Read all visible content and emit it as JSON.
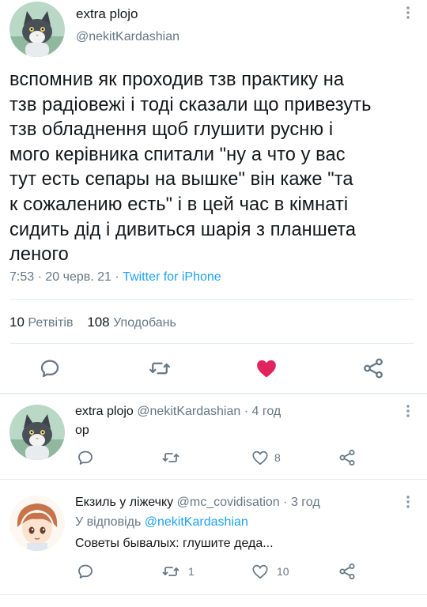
{
  "main_tweet": {
    "display_name": "extra plojo",
    "handle": "@nekitKardashian",
    "text_lines": [
      "вспомнив як проходив тзв практику на",
      "тзв радіовежі і тоді сказали що привезуть",
      "тзв обладнення щоб глушити русню і",
      "мого керівника спитали \"ну а что у вас",
      "тут есть сепары на вышке\" він каже \"та",
      "к сожалению есть\" і в цей час в кімнаті",
      "сидить дід і дивиться шарія з планшета",
      "леного"
    ],
    "time": "7:53",
    "date": "20 черв. 21",
    "separator": "·",
    "source": "Twitter for iPhone",
    "retweets_count": "10",
    "retweets_label": "Ретвітів",
    "likes_count": "108",
    "likes_label": "Уподобань",
    "liked": true,
    "like_color": "#e0245e"
  },
  "replies": [
    {
      "display_name": "extra plojo",
      "handle": "@nekitKardashian",
      "time": "4 год",
      "separator": "·",
      "text": "ор",
      "retweet_count": "",
      "like_count": "8"
    },
    {
      "display_name": "Екзиль у ліжечку",
      "handle": "@mc_covidisation",
      "time": "3 год",
      "separator": "·",
      "reply_to_prefix": "У відповідь",
      "reply_to_handle": "@nekitKardashian",
      "text": "Советы бывалых: глушите деда...",
      "retweet_count": "1",
      "like_count": "10"
    }
  ],
  "colors": {
    "accent": "#1da1f2",
    "secondary_text": "#657786",
    "icon": "#657786",
    "divider": "#e6ecf0"
  },
  "icons": {
    "more": "more-vertical-icon",
    "reply": "reply-icon",
    "retweet": "retweet-icon",
    "like": "heart-icon",
    "share": "share-icon"
  }
}
